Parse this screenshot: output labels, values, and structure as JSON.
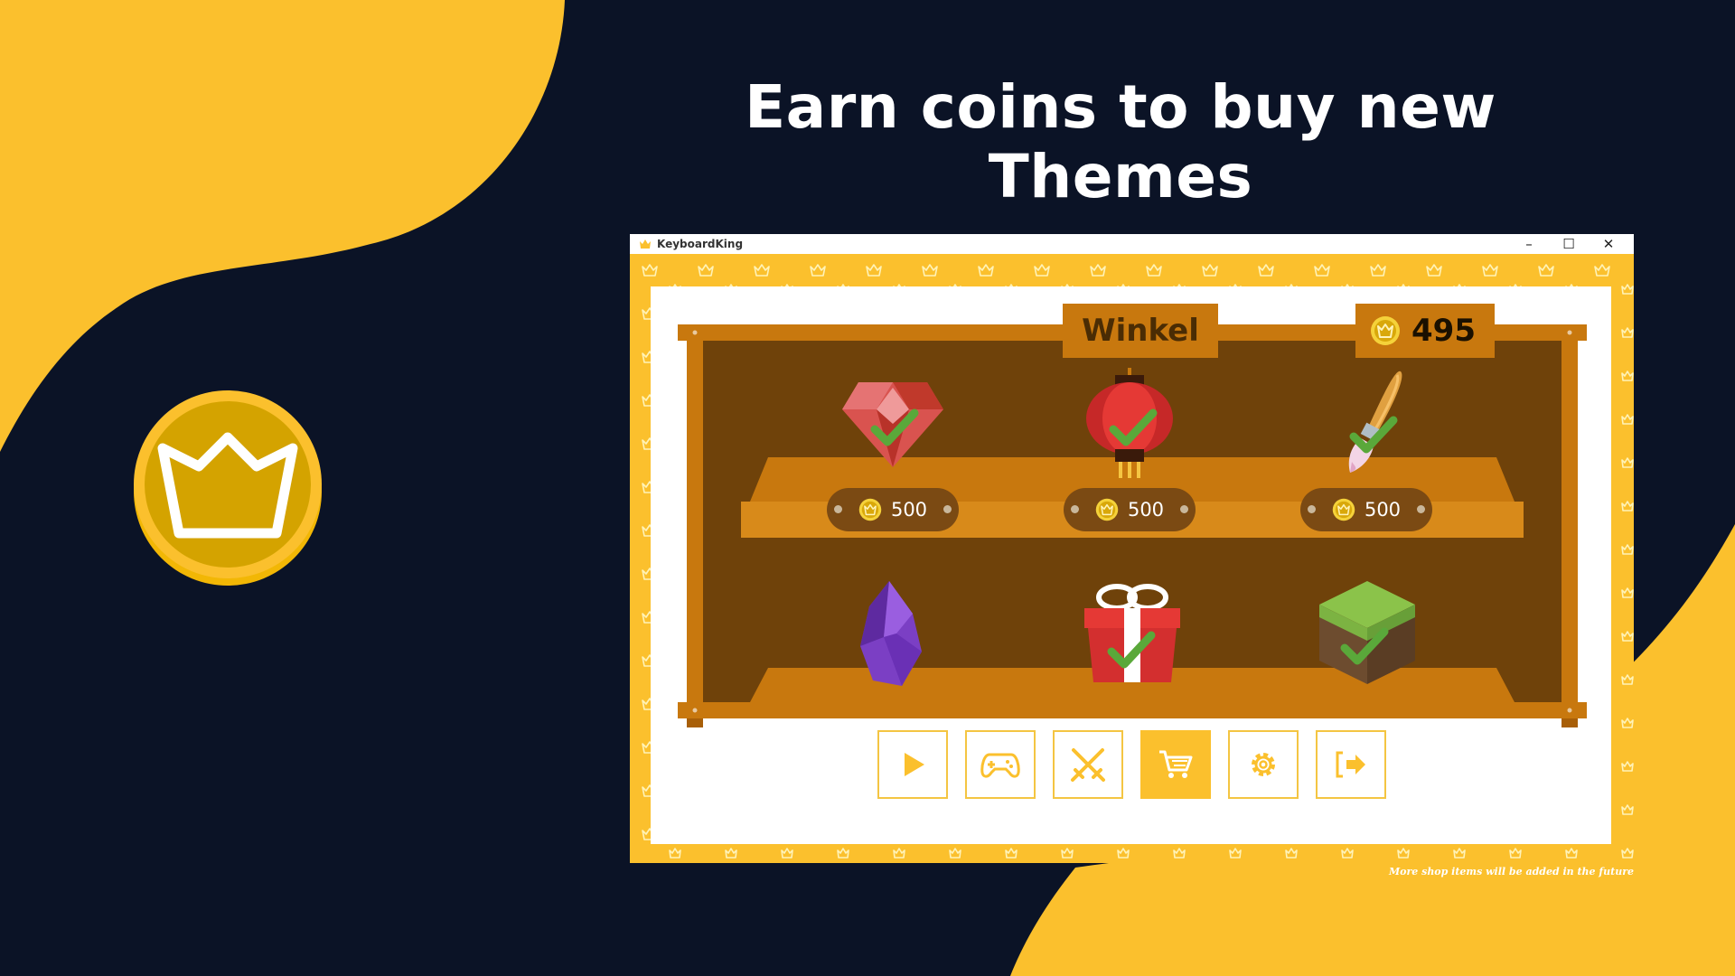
{
  "headline": "Earn coins to buy new Themes",
  "window": {
    "title": "KeyboardKing",
    "controls": {
      "minimize": "–",
      "maximize": "☐",
      "close": "✕"
    }
  },
  "shop": {
    "title": "Winkel",
    "coin_balance": "495",
    "items": [
      {
        "name": "ruby-theme",
        "price": "500",
        "owned": true
      },
      {
        "name": "lantern-theme",
        "price": "500",
        "owned": true
      },
      {
        "name": "brush-theme",
        "price": "500",
        "owned": true
      },
      {
        "name": "crystal-theme",
        "owned": false
      },
      {
        "name": "gift-theme",
        "owned": true
      },
      {
        "name": "grass-block-theme",
        "owned": true
      }
    ]
  },
  "nav": [
    {
      "name": "play",
      "icon": "play-icon",
      "active": false
    },
    {
      "name": "games",
      "icon": "gamepad-icon",
      "active": false
    },
    {
      "name": "battle",
      "icon": "crossed-swords-icon",
      "active": false
    },
    {
      "name": "shop",
      "icon": "cart-icon",
      "active": true
    },
    {
      "name": "settings",
      "icon": "gear-icon",
      "active": false
    },
    {
      "name": "logout",
      "icon": "logout-icon",
      "active": false
    }
  ],
  "footnote": "More shop items will be added in the future",
  "colors": {
    "background": "#0b1326",
    "accent_yellow": "#fbc02d",
    "shelf_wood": "#c8780e",
    "shelf_dark": "#6f420a",
    "check_green": "#5aa83a"
  }
}
